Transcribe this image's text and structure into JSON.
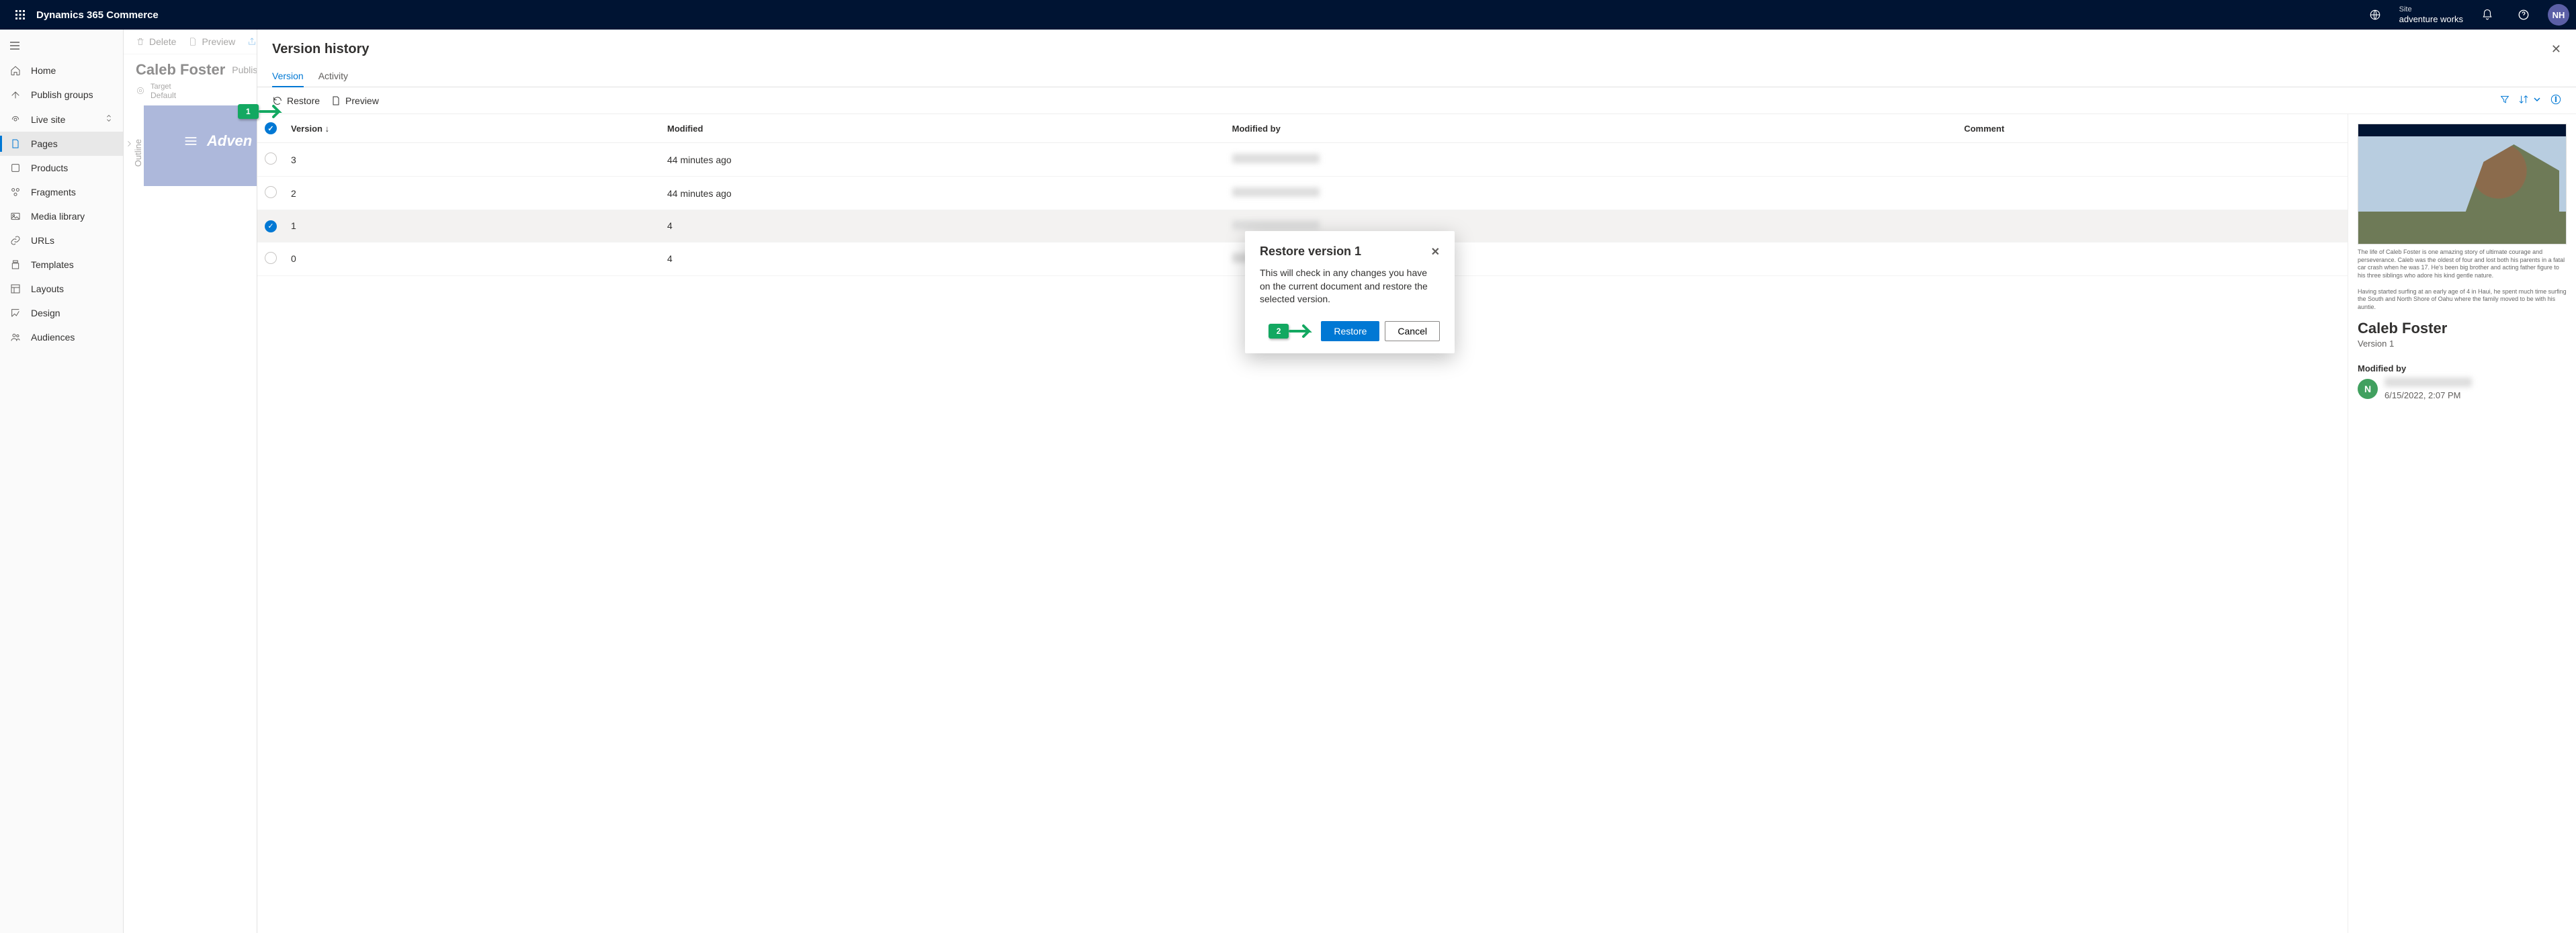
{
  "header": {
    "brand": "Dynamics 365 Commerce",
    "site_label": "Site",
    "site_name": "adventure works",
    "avatar_initials": "NH"
  },
  "sidebar": {
    "items": [
      {
        "label": "Home"
      },
      {
        "label": "Publish groups"
      },
      {
        "label": "Live site"
      },
      {
        "label": "Pages"
      },
      {
        "label": "Products"
      },
      {
        "label": "Fragments"
      },
      {
        "label": "Media library"
      },
      {
        "label": "URLs"
      },
      {
        "label": "Templates"
      },
      {
        "label": "Layouts"
      },
      {
        "label": "Design"
      },
      {
        "label": "Audiences"
      }
    ]
  },
  "page_tools": {
    "delete": "Delete",
    "preview": "Preview"
  },
  "page": {
    "title": "Caleb Foster",
    "status": "Published,",
    "target_label": "Target",
    "target_value": "Default",
    "outline_label": "Outline",
    "canvas_text": "Adven"
  },
  "panel": {
    "title": "Version history",
    "tabs": {
      "version": "Version",
      "activity": "Activity"
    },
    "toolbar": {
      "restore": "Restore",
      "preview": "Preview"
    },
    "columns": {
      "version": "Version",
      "modified": "Modified",
      "modified_by": "Modified by",
      "comment": "Comment"
    },
    "rows": [
      {
        "checked": false,
        "selected": false,
        "version": "3",
        "modified": "44 minutes ago"
      },
      {
        "checked": false,
        "selected": false,
        "version": "2",
        "modified": "44 minutes ago"
      },
      {
        "checked": true,
        "selected": true,
        "version": "1",
        "modified": "4"
      },
      {
        "checked": false,
        "selected": false,
        "version": "0",
        "modified": "4"
      }
    ]
  },
  "details": {
    "title": "Caleb Foster",
    "version_line": "Version 1",
    "modified_by_label": "Modified by",
    "modified_initial": "N",
    "modified_date": "6/15/2022, 2:07 PM",
    "caption1": "The life of Caleb Foster is one amazing story of ultimate courage and perseverance. Caleb was the oldest of four and lost both his parents in a fatal car crash when he was 17. He's been big brother and acting father figure to his three siblings who adore his kind gentle nature.",
    "caption2": "Having started surfing at an early age of 4 in Haui, he spent much time surfing the South and North Shore of Oahu where the family moved to be with his auntie."
  },
  "modal": {
    "title": "Restore version 1",
    "body": "This will check in any changes you have on the current document and restore the selected version.",
    "restore": "Restore",
    "cancel": "Cancel"
  },
  "callouts": {
    "one": "1",
    "two": "2"
  }
}
